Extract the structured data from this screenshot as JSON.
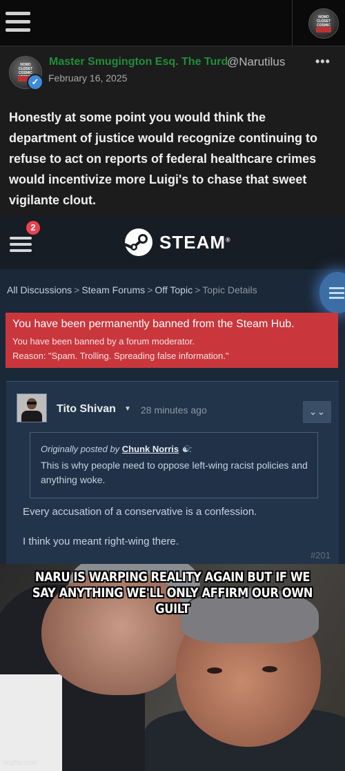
{
  "social_post": {
    "author_name": "Master Smugington Esq. The Turd",
    "author_handle": "@Narutilus",
    "date": "February 16, 2025",
    "more_icon": "•••",
    "body": "Honestly at some point you would think the department of justice would recognize continuing to refuse to act on reports of federal healthcare crimes would incentivize more Luigi's to chase that sweet vigilante clout.",
    "avatar_logo_text": "NOMO CLOSET COSMIC HORROR",
    "verified_icon": "✓"
  },
  "steam": {
    "notification_count": "2",
    "brand": "STEAM",
    "trademark": "®",
    "breadcrumbs": [
      "All Discussions",
      "Steam Forums",
      "Off Topic",
      "Topic Details"
    ],
    "breadcrumb_sep": ">",
    "ban_title": "You have been permanently banned from the Steam Hub.",
    "ban_subtitle": "You have been banned by a forum moderator.",
    "ban_reason": "Reason: \"Spam. Trolling. Spreading false information.\"",
    "comment": {
      "author": "Tito Shivan",
      "caret": "▼",
      "time": "28 minutes ago",
      "expand_icon": "⌄⌄",
      "quote_prefix": "Originally posted by",
      "quote_author": "Chunk Norris",
      "quote_author_icon": "☯",
      "quote_suffix": ":",
      "quote_text": "This is why people need to oppose left-wing racist policies and anything woke.",
      "reply_line_1": "Every accusation of a conservative is a confession.",
      "reply_line_2": "I think you meant right-wing there.",
      "post_number": "#201"
    }
  },
  "meme": {
    "caption": "NARU IS WARPING REALITY AGAIN BUT IF WE SAY ANYTHING WE'LL ONLY AFFIRM OUR OWN GUILT",
    "watermark": "imgflip.com"
  }
}
